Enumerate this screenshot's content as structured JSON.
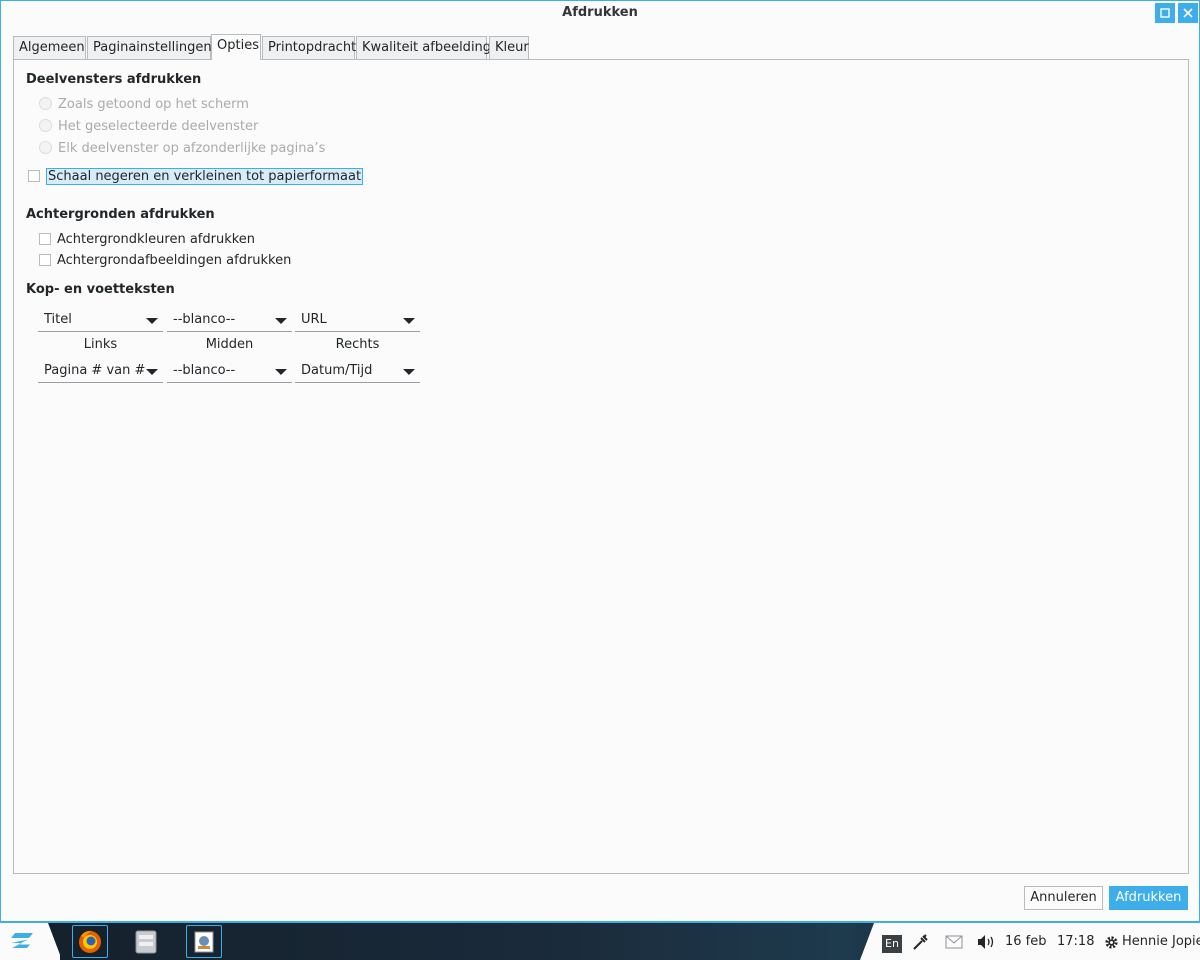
{
  "window": {
    "title": "Afdrukken"
  },
  "tabs": [
    {
      "label": "Algemeen"
    },
    {
      "label": "Paginainstellingen"
    },
    {
      "label": "Opties"
    },
    {
      "label": "Printopdracht"
    },
    {
      "label": "Kwaliteit afbeelding"
    },
    {
      "label": "Kleur"
    }
  ],
  "active_tab": "Opties",
  "frames": {
    "heading": "Deelvensters afdrukken",
    "options": [
      {
        "label": "Zoals getoond op het scherm",
        "enabled": false
      },
      {
        "label": "Het geselecteerde deelvenster",
        "enabled": false
      },
      {
        "label": "Elk deelvenster op afzonderlijke pagina’s",
        "enabled": false
      }
    ],
    "shrink_checkbox": {
      "label": "Schaal negeren en verkleinen tot papierformaat",
      "checked": false
    }
  },
  "backgrounds": {
    "heading": "Achtergronden afdrukken",
    "colors_checkbox": {
      "label": "Achtergrondkleuren afdrukken",
      "checked": false
    },
    "images_checkbox": {
      "label": "Achtergrondafbeeldingen afdrukken",
      "checked": false
    }
  },
  "header_footer": {
    "heading": "Kop- en voetteksten",
    "header": {
      "left": "Titel",
      "center": "--blanco--",
      "right": "URL"
    },
    "labels": {
      "left": "Links",
      "center": "Midden",
      "right": "Rechts"
    },
    "footer": {
      "left": "Pagina # van #",
      "center": "--blanco--",
      "right": "Datum/Tijd"
    }
  },
  "buttons": {
    "cancel": "Annuleren",
    "print": "Afdrukken"
  },
  "taskbar": {
    "apps": [
      "firefox-icon",
      "file-manager-icon",
      "printer-app-icon"
    ],
    "tray": {
      "lang": "En",
      "date": "16 feb",
      "time": "17:18",
      "user": "Hennie Jopie"
    }
  },
  "colors": {
    "accent": "#3daee9",
    "window_bg": "#fbfbfb",
    "text": "#232629",
    "disabled_text": "#a8abae"
  }
}
